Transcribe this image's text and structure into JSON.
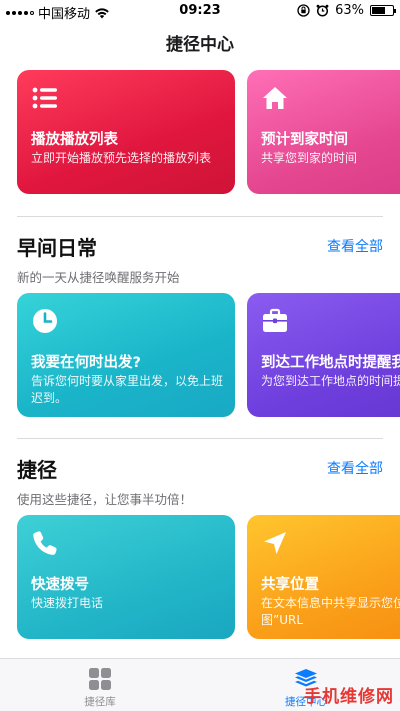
{
  "status_bar": {
    "carrier": "中国移动",
    "time": "09:23",
    "battery": "63%",
    "battery_level": 0.63
  },
  "nav": {
    "title": "捷径中心"
  },
  "top_cards": [
    {
      "title": "播放播放列表",
      "desc": "立即开始播放预先选择的播放列表",
      "icon": "list-icon",
      "color": "#e0163f"
    },
    {
      "title": "预计到家时间",
      "desc": "共享您到家的时间",
      "icon": "home-icon",
      "color": "#e4468f"
    }
  ],
  "sections": [
    {
      "title": "早间日常",
      "see_all": "查看全部",
      "subtitle": "新的一天从捷径唤醒服务开始",
      "cards": [
        {
          "title": "我要在何时出发?",
          "desc": "告诉您何时要从家里出发，以免上班迟到。",
          "icon": "clock-icon",
          "color": "#1ab4c9"
        },
        {
          "title": "到达工作地点时提醒我",
          "desc": "为您到达工作地点的时间提醒事项",
          "icon": "briefcase-icon",
          "color": "#6e3fdd"
        }
      ]
    },
    {
      "title": "捷径",
      "see_all": "查看全部",
      "subtitle": "使用这些捷径，让您事半功倍！",
      "cards": [
        {
          "title": "快速拨号",
          "desc": "快速拨打电话",
          "icon": "phone-icon",
          "color": "#22b6c8"
        },
        {
          "title": "共享位置",
          "desc": "在文本信息中共享显示您位置的“地图”URL",
          "icon": "location-arrow-icon",
          "color": "#fa9e18"
        }
      ]
    }
  ],
  "tab_bar": {
    "library": "捷径库",
    "gallery": "捷径中心"
  },
  "watermark": "手机维修网"
}
